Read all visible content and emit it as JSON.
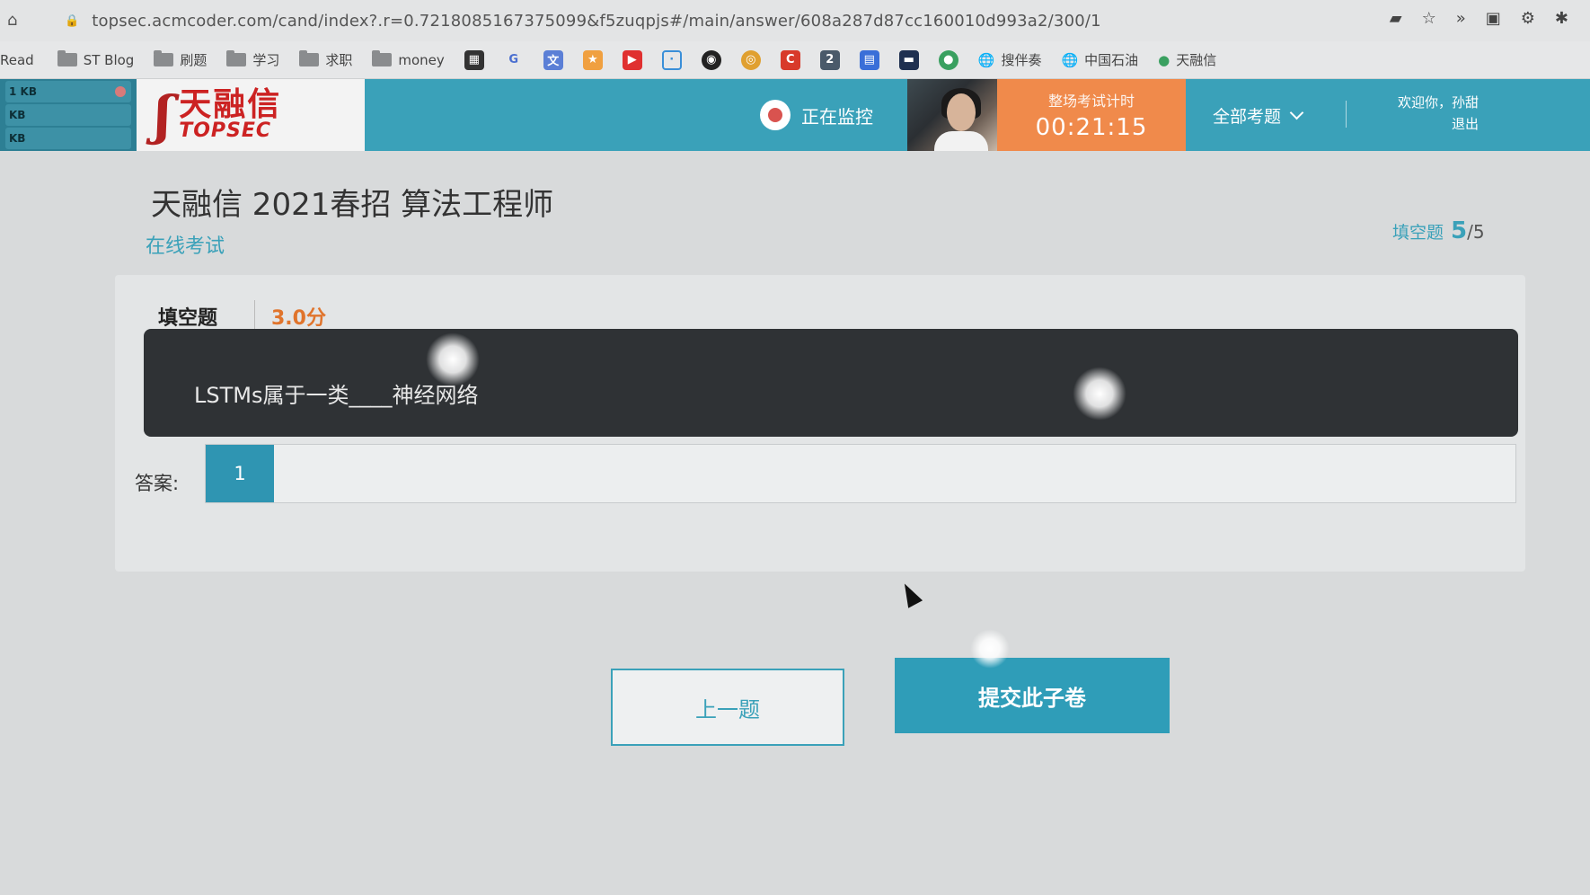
{
  "browser": {
    "url": "topsec.acmcoder.com/cand/index?.r=0.7218085167375099&f5zuqpjs#/main/answer/608a287d87cc160010d993a2/300/1",
    "bookmarks": [
      {
        "label": "Read",
        "type": "text"
      },
      {
        "label": "ST Blog",
        "type": "folder"
      },
      {
        "label": "刷题",
        "type": "folder"
      },
      {
        "label": "学习",
        "type": "folder"
      },
      {
        "label": "求职",
        "type": "folder"
      },
      {
        "label": "money",
        "type": "folder"
      }
    ],
    "extra_bookmarks": [
      "搜伴奏",
      "中国石油",
      "天融信"
    ]
  },
  "side_panel": {
    "rows": [
      "1 KB",
      "KB",
      "KB"
    ]
  },
  "header": {
    "logo_cn": "天融信",
    "logo_en": "TOPSEC",
    "monitor_label": "正在监控",
    "timer_label": "整场考试计时",
    "timer_value": "00:21:15",
    "all_questions": "全部考题",
    "welcome": "欢迎你，孙甜",
    "logout": "退出"
  },
  "exam": {
    "title": "天融信 2021春招 算法工程师",
    "subtitle": "在线考试",
    "progress_label": "填空题",
    "progress_current": "5",
    "progress_total": "/5"
  },
  "question": {
    "type": "填空题",
    "score": "3.0分",
    "text": "LSTMs属于一类____神经网络"
  },
  "answer": {
    "label": "答案:",
    "blank_number": "1",
    "value": ""
  },
  "buttons": {
    "prev": "上一题",
    "submit": "提交此子卷"
  }
}
